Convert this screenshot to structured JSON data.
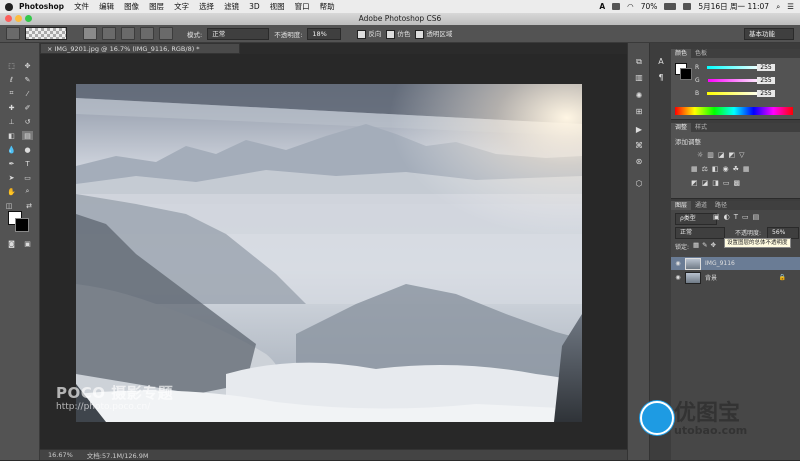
{
  "menubar": {
    "app": "Photoshop",
    "items": [
      "文件",
      "编辑",
      "图像",
      "图层",
      "文字",
      "选择",
      "滤镜",
      "3D",
      "视图",
      "窗口",
      "帮助"
    ],
    "battery": "70%",
    "datetime": "5月16日 周一  11:07"
  },
  "window": {
    "title": "Adobe Photoshop CS6"
  },
  "options": {
    "mode_label": "模式:",
    "mode_value": "正常",
    "opacity_label": "不透明度:",
    "opacity_value": "18%",
    "reverse_label": "反向",
    "dither_label": "仿色",
    "transparency_label": "透明区域",
    "workspace": "基本功能"
  },
  "document": {
    "tab_title": "IMG_9201.jpg @ 16.7% (IMG_9116, RGB/8) *",
    "zoom": "16.67%",
    "docsize": "文档:57.1M/126.9M"
  },
  "color_panel": {
    "tabs": [
      "颜色",
      "色板"
    ],
    "channels": [
      {
        "label": "R",
        "value": "255",
        "gradient": "linear-gradient(90deg,#00ffff,#ffffff)"
      },
      {
        "label": "G",
        "value": "255",
        "gradient": "linear-gradient(90deg,#ff00ff,#ffffff)"
      },
      {
        "label": "B",
        "value": "255",
        "gradient": "linear-gradient(90deg,#ffff00,#ffffff)"
      }
    ]
  },
  "adjustments_panel": {
    "tabs": [
      "调整",
      "样式"
    ],
    "title": "添加调整"
  },
  "layers_panel": {
    "tabs": [
      "图层",
      "通道",
      "路径"
    ],
    "filter": "ρ类型",
    "blend_mode": "正常",
    "opacity_label": "不透明度:",
    "opacity_value": "56%",
    "lock_label": "锁定:",
    "tooltip": "设置图层的总体不透明度",
    "layers": [
      {
        "name": "IMG_9116",
        "selected": true
      },
      {
        "name": "背景",
        "selected": false,
        "locked": true
      }
    ]
  },
  "watermarks": {
    "left_brand": "POCO 摄影专题",
    "left_url": "http://photo.poco.cn/",
    "right_brand": "优图宝",
    "right_url": "utobao.com"
  }
}
